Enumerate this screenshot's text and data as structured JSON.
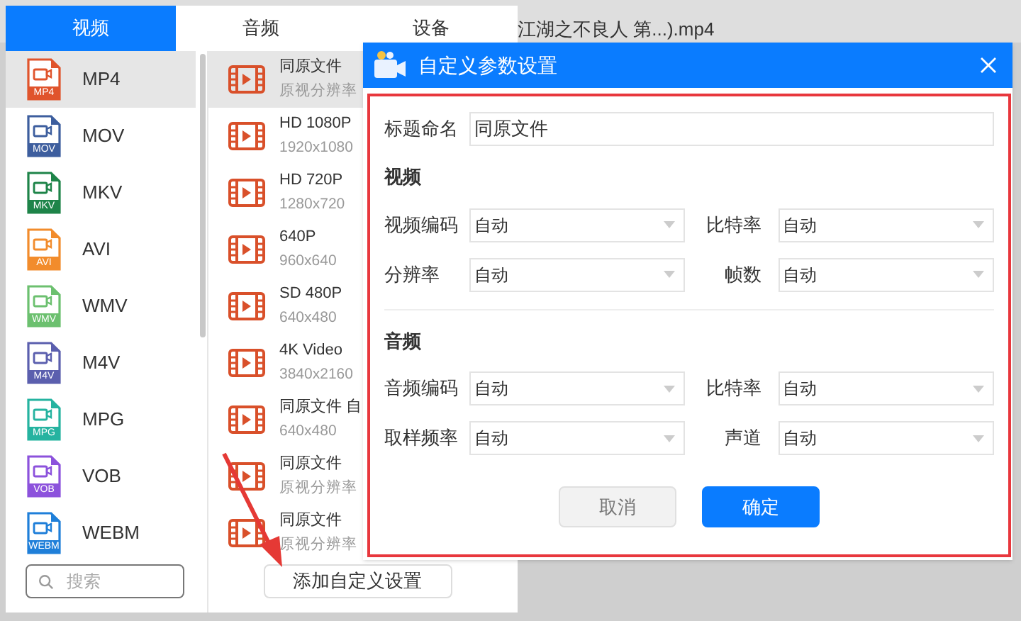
{
  "background_file": {
    "name": "江湖之不良人 第...).mp4"
  },
  "tabs": [
    {
      "label": "视频",
      "selected": true
    },
    {
      "label": "音频",
      "selected": false
    },
    {
      "label": "设备",
      "selected": false
    }
  ],
  "formats": [
    {
      "name": "MP4",
      "badge": "MP4",
      "color": "#e0542c",
      "selected": true
    },
    {
      "name": "MOV",
      "badge": "MOV",
      "color": "#3d5e9e",
      "selected": false
    },
    {
      "name": "MKV",
      "badge": "MKV",
      "color": "#1e8449",
      "selected": false
    },
    {
      "name": "AVI",
      "badge": "AVI",
      "color": "#f28c2c",
      "selected": false
    },
    {
      "name": "WMV",
      "badge": "WMV",
      "color": "#6cc06f",
      "selected": false
    },
    {
      "name": "M4V",
      "badge": "M4V",
      "color": "#5b5fae",
      "selected": false
    },
    {
      "name": "MPG",
      "badge": "MPG",
      "color": "#25b3a0",
      "selected": false
    },
    {
      "name": "VOB",
      "badge": "VOB",
      "color": "#8c52dc",
      "selected": false
    },
    {
      "name": "WEBM",
      "badge": "WEBM",
      "color": "#1f7fd9",
      "selected": false
    }
  ],
  "search": {
    "placeholder": "搜索"
  },
  "presets": [
    {
      "title": "同原文件",
      "subtitle": "原视分辨率",
      "selected": true
    },
    {
      "title": "HD 1080P",
      "subtitle": "1920x1080",
      "selected": false
    },
    {
      "title": "HD 720P",
      "subtitle": "1280x720",
      "selected": false
    },
    {
      "title": "640P",
      "subtitle": "960x640",
      "selected": false
    },
    {
      "title": "SD 480P",
      "subtitle": "640x480",
      "selected": false
    },
    {
      "title": "4K Video",
      "subtitle": "3840x2160",
      "selected": false
    },
    {
      "title": "同原文件 自",
      "subtitle": "640x480",
      "selected": false
    },
    {
      "title": "同原文件",
      "subtitle": "原视分辨率",
      "selected": false
    },
    {
      "title": "同原文件",
      "subtitle": "原视分辨率",
      "selected": false
    }
  ],
  "add_custom_button": "添加自定义设置",
  "dialog": {
    "title": "自定义参数设置",
    "name_label": "标题命名",
    "name_value": "同原文件",
    "sections": [
      {
        "heading": "视频",
        "rows": [
          [
            {
              "label": "视频编码",
              "value": "自动"
            },
            {
              "label": "比特率",
              "value": "自动"
            }
          ],
          [
            {
              "label": "分辨率",
              "value": "自动"
            },
            {
              "label": "帧数",
              "value": "自动"
            }
          ]
        ]
      },
      {
        "heading": "音频",
        "rows": [
          [
            {
              "label": "音频编码",
              "value": "自动"
            },
            {
              "label": "比特率",
              "value": "自动"
            }
          ],
          [
            {
              "label": "取样频率",
              "value": "自动"
            },
            {
              "label": "声道",
              "value": "自动"
            }
          ]
        ]
      }
    ],
    "buttons": [
      {
        "label": "取消",
        "kind": "secondary"
      },
      {
        "label": "确定",
        "kind": "primary"
      }
    ]
  }
}
